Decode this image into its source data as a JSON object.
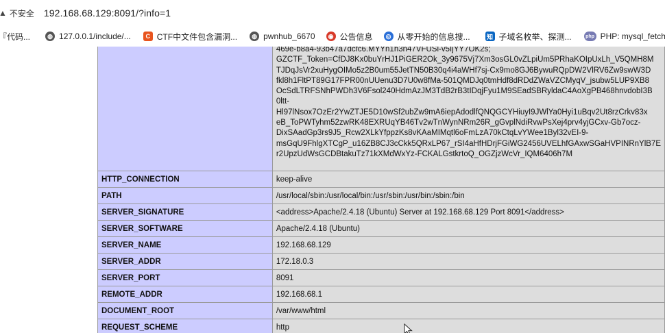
{
  "browser": {
    "security_label": "不安全",
    "url": "192.168.68.129:8091/?info=1"
  },
  "bookmarks": [
    {
      "label": "『代码...",
      "icon": "folder-icon",
      "color": "#666666"
    },
    {
      "label": "127.0.0.1/include/...",
      "icon": "globe-icon",
      "color": "#555555"
    },
    {
      "label": "CTF中文件包含漏洞...",
      "icon": "c-logo-icon",
      "color": "#e8541e"
    },
    {
      "label": "pwnhub_6670",
      "icon": "globe-icon",
      "color": "#555555"
    },
    {
      "label": "公告信息",
      "icon": "red-logo-icon",
      "color": "#d83a2a"
    },
    {
      "label": "从零开始的信息搜...",
      "icon": "blue-logo-icon",
      "color": "#2a6fd8"
    },
    {
      "label": "子域名枚举、探测...",
      "icon": "zhihu-icon",
      "color": "#0a66c2"
    },
    {
      "label": "PHP: mysql_fetch_...",
      "icon": "php-icon",
      "color": "#777bb3"
    }
  ],
  "cookie_value_lines": [
    "469e-b8a4-93b47a7dcfc6.MYYn1h3n47VFUSl-v5IjYY7OK2s;",
    "GZCTF_Token=CfDJ8Kx0buYrHJ1PiGER2Ok_3y9675Vj7Xm3osGL0vZLpiUm5PRhaKOIpUxLh_V5QMH8M",
    "TJDqJsVr2xuHygOIMo5z2B0um55JetTN50B30q4i4aWHf7sj-Cx9mo8GJ6BywuRQpDW2VlRV6Zw9swW3D",
    "fkl8h1FltPT89G17FPR00nUUenu3D7U0w8fMa-501QMDJq0tmHdf8dRDdZWaVZCMyqV_jsubw5LUP9XB8",
    "OcSdLTRFSNhPWDh3V6Fsol240HdmAzJM3TdB2rB3tIDqjFyu1M9SEadSBRyldaC4AoXgPB468hnvdobI3B",
    "0ltt-",
    "Hl97lNsox7OzEr2YwZTJE5D10wSf2ubZw9mA6iepAdodlfQNQGCYHiuyI9JWlYa0Hyi1uBqv2Ut8rzCrkv83x",
    "eB_ToPWTyhm52zwRK48EXRUqYB46Tv2wTnWynNRm26R_gGvplNdiRvwPsXej4prv4yjGCxv-Gb7ocz-",
    "DixSAadGp3rs9J5_Rcw2XLkYfppzKs8vKAaMIMqtl6oFmLzA70kCtqLvYWee1Byl32vEI-9-",
    "msGqU9FhlgXTCgP_u16ZB8CJ3cCkk5QRxLP67_rSI4aHfHDrjFGiWG2456UVELhfGAxwSGaHVPINRnYlB7E",
    "r2UpzUdWsGCDBtakuTz71kXMdWxYz-FCKALGstkrtoQ_OGZjzWcVr_IQM6406h7M"
  ],
  "rows": [
    {
      "key": "HTTP_CONNECTION",
      "value": "keep-alive"
    },
    {
      "key": "PATH",
      "value": "/usr/local/sbin:/usr/local/bin:/usr/sbin:/usr/bin:/sbin:/bin"
    },
    {
      "key": "SERVER_SIGNATURE",
      "value": "<address>Apache/2.4.18 (Ubuntu) Server at 192.168.68.129 Port 8091</address>"
    },
    {
      "key": "SERVER_SOFTWARE",
      "value": "Apache/2.4.18 (Ubuntu)"
    },
    {
      "key": "SERVER_NAME",
      "value": "192.168.68.129"
    },
    {
      "key": "SERVER_ADDR",
      "value": "172.18.0.3"
    },
    {
      "key": "SERVER_PORT",
      "value": "8091"
    },
    {
      "key": "REMOTE_ADDR",
      "value": "192.168.68.1"
    },
    {
      "key": "DOCUMENT_ROOT",
      "value": "/var/www/html"
    },
    {
      "key": "REQUEST_SCHEME",
      "value": "http"
    }
  ],
  "colors": {
    "key_cell": "#ccccff",
    "value_cell": "#dddddd",
    "border": "#9a9a9a"
  }
}
